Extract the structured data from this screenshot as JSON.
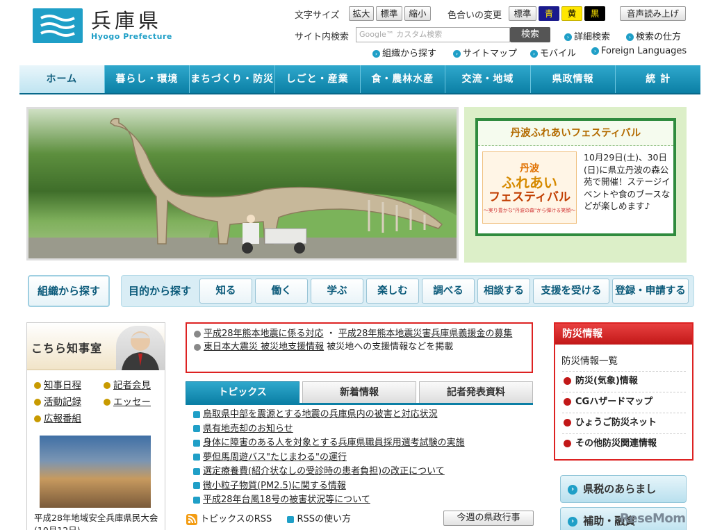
{
  "header": {
    "logo_ja": "兵庫県",
    "logo_en": "Hyogo Prefecture",
    "text_size_label": "文字サイズ",
    "text_size_buttons": [
      "拡大",
      "標準",
      "縮小"
    ],
    "color_change_label": "色合いの変更",
    "color_buttons": [
      "標準",
      "青",
      "黄",
      "黒"
    ],
    "voice_button": "音声読み上げ",
    "search_label": "サイト内検索",
    "search_placeholder": "Google™ カスタム検索",
    "search_button": "検索",
    "detail_search": "詳細検索",
    "search_howto": "検索の仕方",
    "sub_links": [
      "組織から探す",
      "サイトマップ",
      "モバイル",
      "Foreign Languages"
    ]
  },
  "nav": [
    "ホーム",
    "暮らし・環境",
    "まちづくり・防災",
    "しごと・産業",
    "食・農林水産",
    "交流・地域",
    "県政情報",
    "統 計"
  ],
  "festival": {
    "title": "丹波ふれあいフェスティバル",
    "image_title": "ふれあい",
    "image_title2": "フェスティバル",
    "image_sub": "～実り豊かな\"丹波の森\"から弾ける笑顔～",
    "image_top": "丹波",
    "text": "10月29日(土)、30日(日)に県立丹波の森公苑で開催！ステージイベントや食のブースなどが楽しめます♪"
  },
  "purpose": {
    "org_button": "組織から探す",
    "label": "目的から探す",
    "buttons": [
      "知る",
      "働く",
      "学ぶ",
      "楽しむ",
      "調べる",
      "相談する",
      "支援を受ける",
      "登録・申請する"
    ]
  },
  "governor": {
    "title": "こちら知事室",
    "links": [
      "知事日程",
      "記者会見",
      "活動記録",
      "エッセー",
      "広報番組"
    ],
    "caption": "平成28年地域安全兵庫県民大会(10月12日)"
  },
  "alert": {
    "link1": "平成28年熊本地震に係る対応",
    "sep": "・",
    "link2": "平成28年熊本地震災害兵庫県義援金の募集",
    "link3": "東日本大震災 被災地支援情報",
    "text3": "被災地への支援情報などを掲載"
  },
  "tabs": [
    "トピックス",
    "新着情報",
    "記者発表資料"
  ],
  "topics": [
    "鳥取県中部を震源とする地震の兵庫県内の被害と対応状況",
    "県有地売却のお知らせ",
    "身体に障害のある人を対象とする兵庫県職員採用選考試験の実施",
    "夢但馬周遊バス\"たじまわる\"の運行",
    "選定療養費(紹介状なしの受診時の患者負担)の改正について",
    "微小粒子物質(PM2.5)に関する情報",
    "平成28年台風18号の被害状況等について"
  ],
  "rss": {
    "topics_rss": "トピックスのRSS",
    "rss_howto": "RSSの使い方",
    "weekly": "今週の県政行事"
  },
  "disaster": {
    "title": "防災情報",
    "list_title": "防災情報一覧",
    "items": [
      "防災(気象)情報",
      "CGハザードマップ",
      "ひょうご防災ネット",
      "その他防災関連情報"
    ]
  },
  "side_buttons": [
    "県税のあらまし",
    "補助・融資"
  ],
  "watermark": "ReseMom"
}
